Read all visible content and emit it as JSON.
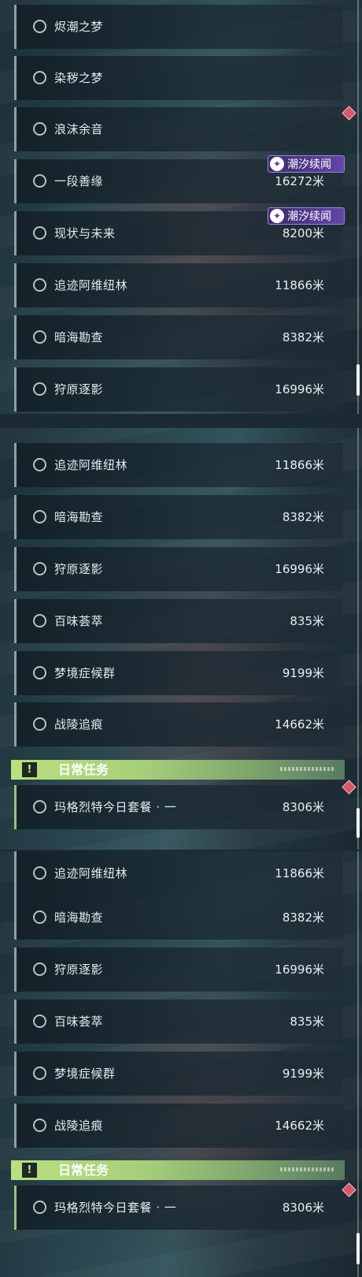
{
  "tag_label": "潮汐续闻",
  "tag_icon": "swirl-emblem-icon",
  "daily_header_title": "日常任务",
  "daily_header_icon": "exclamation-icon",
  "panel1": {
    "rows": [
      {
        "name": "烬潮之梦",
        "dist": ""
      },
      {
        "name": "染秽之梦",
        "dist": ""
      },
      {
        "name": "浪沫余音",
        "dist": ""
      },
      {
        "name": "一段善缘",
        "dist": "16272米"
      },
      {
        "name": "现状与未来",
        "dist": "8200米"
      },
      {
        "name": "追迹阿维纽林",
        "dist": "11866米"
      },
      {
        "name": "暗海勘查",
        "dist": "8382米"
      },
      {
        "name": "狩原逐影",
        "dist": "16996米"
      }
    ]
  },
  "panel2": {
    "rows": [
      {
        "name": "追迹阿维纽林",
        "dist": "11866米"
      },
      {
        "name": "暗海勘查",
        "dist": "8382米"
      },
      {
        "name": "狩原逐影",
        "dist": "16996米"
      },
      {
        "name": "百味荟萃",
        "dist": "835米"
      },
      {
        "name": "梦境症候群",
        "dist": "9199米"
      },
      {
        "name": "战陵追痕",
        "dist": "14662米"
      }
    ],
    "daily": {
      "name": "玛格烈特今日套餐 · 一",
      "dist": "8306米"
    }
  },
  "panel3": {
    "rows": [
      {
        "name": "追迹阿维纽林",
        "dist": "11866米"
      },
      {
        "name": "暗海勘查",
        "dist": "8382米"
      },
      {
        "name": "狩原逐影",
        "dist": "16996米"
      },
      {
        "name": "百味荟萃",
        "dist": "835米"
      },
      {
        "name": "梦境症候群",
        "dist": "9199米"
      },
      {
        "name": "战陵追痕",
        "dist": "14662米"
      }
    ],
    "daily": {
      "name": "玛格烈特今日套餐 · 一",
      "dist": "8306米"
    }
  },
  "colors": {
    "tag_purple": "#6446a8",
    "daily_green": "#b9e07f",
    "gem_red": "#d9556a"
  }
}
